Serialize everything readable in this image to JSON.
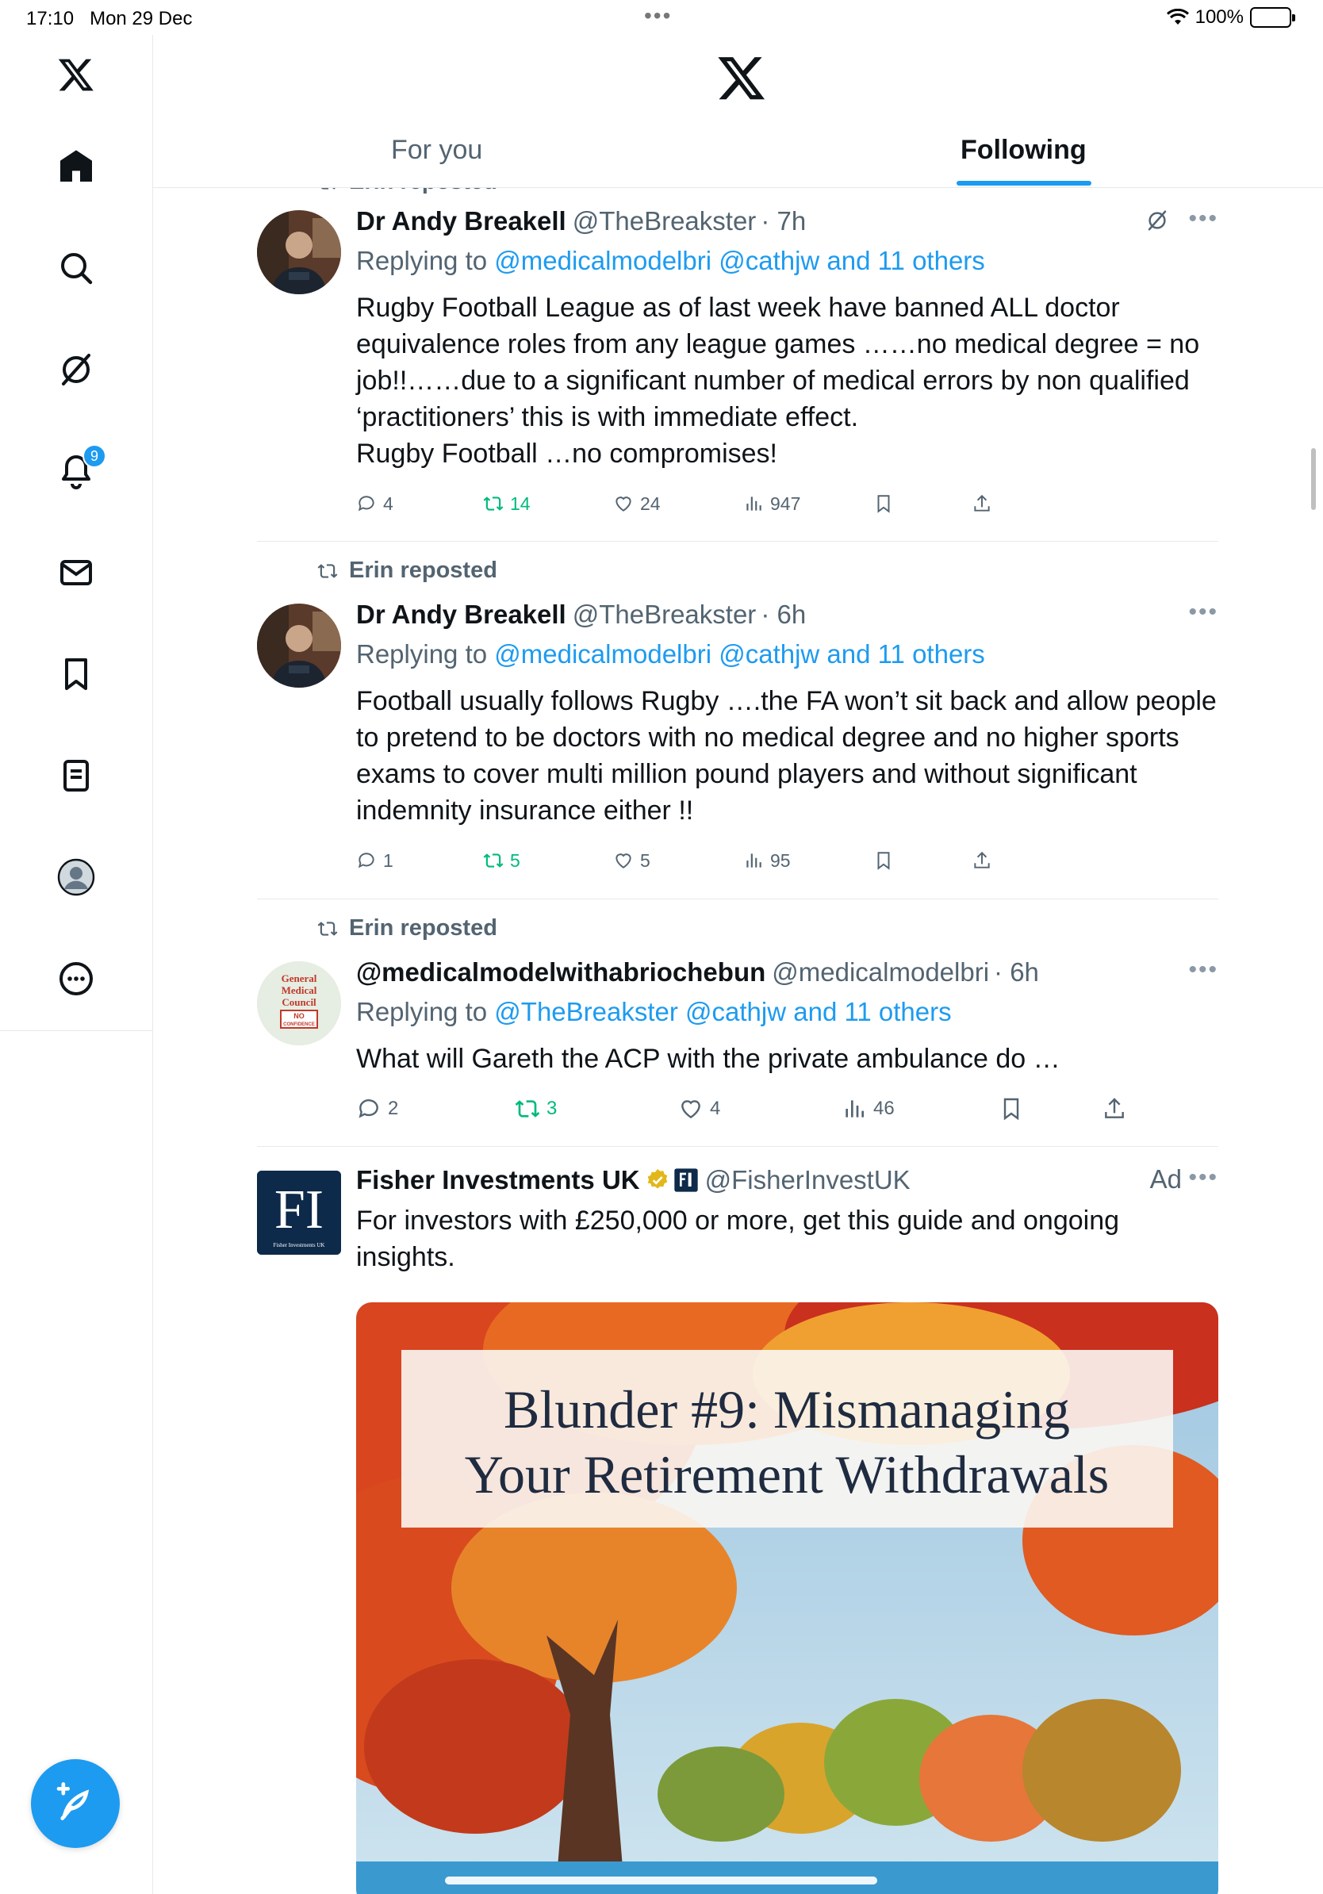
{
  "status_bar": {
    "time": "17:10",
    "date": "Mon 29 Dec",
    "battery": "100%"
  },
  "sidebar": {
    "notifications_badge": "9"
  },
  "header": {
    "tabs": [
      {
        "label": "For you"
      },
      {
        "label": "Following"
      }
    ]
  },
  "posts": [
    {
      "repost_label": "Erin reposted",
      "name": "Dr Andy Breakell",
      "handle": "@TheBreakster",
      "time": "· 7h",
      "reply_prefix": "Replying to",
      "reply_links": "@medicalmodelbri @cathjw and 11 others",
      "text_lines": [
        "Rugby Football League as of last week have banned ALL doctor",
        "equivalence roles from any league games ……no medical degree = no",
        "job!!……due to a significant number of medical errors by non qualified",
        "‘practitioners’ this is with immediate effect.",
        "Rugby Football …no compromises!"
      ],
      "replies": "4",
      "reposts": "14",
      "likes": "24",
      "views": "947"
    },
    {
      "repost_label": "Erin reposted",
      "name": "Dr Andy Breakell",
      "handle": "@TheBreakster",
      "time": "· 6h",
      "reply_prefix": "Replying to",
      "reply_links": "@medicalmodelbri @cathjw and 11 others",
      "text_lines": [
        "Football usually follows Rugby ….the FA won’t sit back and  allow people",
        "to pretend to be doctors with no medical degree and no higher sports",
        "exams to cover multi million pound players and without significant",
        "indemnity insurance either !!"
      ],
      "replies": "1",
      "reposts": "5",
      "likes": "5",
      "views": "95"
    },
    {
      "repost_label": "Erin reposted",
      "name": "@medicalmodelwithabriochebun",
      "handle": "@medicalmodelbri",
      "time": "· 6h",
      "reply_prefix": "Replying to",
      "reply_links": "@TheBreakster @cathjw and 11 others",
      "text_lines": [
        "What will Gareth the ACP with the private ambulance do …"
      ],
      "replies": "2",
      "reposts": "3",
      "likes": "4",
      "views": "46",
      "avatar_text": [
        "General",
        "Medical",
        "Council",
        "NO",
        "CONFIDENCE"
      ]
    }
  ],
  "ad": {
    "name": "Fisher Investments UK",
    "handle": "@FisherInvestUK",
    "label": "Ad",
    "text_lines": [
      "For investors with £250,000 or more, get this guide and ongoing",
      "insights."
    ],
    "logo_text": "FI",
    "logo_sub": "Fisher Investments UK",
    "image_title_1": "Blunder #9: Mismanaging",
    "image_title_2": "Your Retirement Withdrawals"
  }
}
